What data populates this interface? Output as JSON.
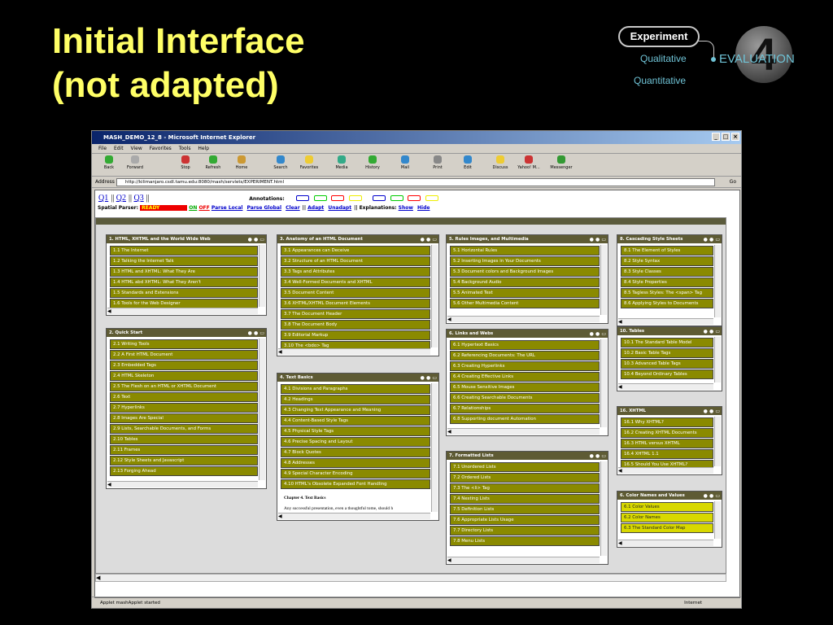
{
  "slide": {
    "title_line1": "Initial Interface",
    "title_line2": "(not adapted)",
    "badge": "Experiment",
    "qualitative": "Qualitative",
    "quantitative": "Quantitative",
    "evaluation": "EVALUATION",
    "number": "4"
  },
  "window": {
    "title": "MASH_DEMO_12_8 - Microsoft Internet Explorer",
    "menu": [
      "File",
      "Edit",
      "View",
      "Favorites",
      "Tools",
      "Help"
    ],
    "toolbar": [
      "Back",
      "Forward",
      "Stop",
      "Refresh",
      "Home",
      "Search",
      "Favorites",
      "Media",
      "History",
      "Mail",
      "Print",
      "Edit",
      "Discuss",
      "Yahoo! M...",
      "Messenger"
    ],
    "address_label": "Address",
    "url": "http://kilimanjaro.csdl.tamu.edu:8080/mash/servlets/EXPERIMENT.html",
    "go": "Go",
    "status_left": "Applet mashApplet started",
    "status_right": "Internet"
  },
  "app": {
    "q": [
      "Q1",
      "Q2",
      "Q3"
    ],
    "annotations": "Annotations:",
    "spatial_parser": "Spatial Parser:",
    "ready": "READY",
    "on": "ON",
    "off": "OFF",
    "parse_local": "Parse Local",
    "parse_global": "Parse Global",
    "clear": "Clear",
    "adapt": "Adapt",
    "unadapt": "Unadapt",
    "explanations": "Explanations:",
    "show": "Show",
    "hide": "Hide",
    "chapter_title": "Chapter 4. Text Basics",
    "chapter_text": "Any successful presentation, even a thoughtful tome, should h"
  },
  "panels": [
    {
      "title": "1. HTML, XHTML and the World Wide Web",
      "items": [
        "1.1 The Internet",
        "1.2 Talking the Internet Talk",
        "1.3 HTML and XHTML: What They Are",
        "1.4 HTML abd XHTML: What They Aren't",
        "1.5 Standards and Extensions",
        "1.6 Tools for the Web Designer"
      ]
    },
    {
      "title": "2. Quick Start",
      "items": [
        "2.1 Writing Tools",
        "2.2 A First HTML Document",
        "2.3 Embedded Tags",
        "2.4 HTML Skeleton",
        "2.5 The Flesh on an HTML or XHTML Document",
        "2.6 Text",
        "2.7 Hyperlinks",
        "2.8 Images Are Special",
        "2.9 Lists, Searchable Documents, and Forms",
        "2.10 Tables",
        "2.11 Frames",
        "2.12 Style Sheets and Javascript",
        "2.13 Forging Ahead"
      ]
    },
    {
      "title": "3. Anatomy of an HTML Document",
      "items": [
        "3.1 Appearances can Deceive",
        "3.2 Structure of an HTML Document",
        "3.3 Tags and Attributes",
        "3.4 Well-Formed Documents and XHTML",
        "3.5 Document Content",
        "3.6 XHTML/XHTML Document Elements",
        "3.7 The Document Header",
        "3.8 The Document Body",
        "3.9 Editorial Markup",
        "3.10 The <bdo> Tag"
      ]
    },
    {
      "title": "4. Text Basics",
      "items": [
        "4.1 Divisions and Paragraphs",
        "4.2 Headings",
        "4.3 Changing Text Appearance and Meaning",
        "4.4 Content-Based Style Tags",
        "4.5 Physical Style Tags",
        "4.6 Precise Spacing and Layout",
        "4.7 Block Quotes",
        "4.8 Addresses",
        "4.9 Special Character Encoding",
        "4.10 HTML's Obsolete Expanded Font Handling"
      ]
    },
    {
      "title": "5. Rules Images, and Multimedia",
      "items": [
        "5.1 Horizontal Rules",
        "5.2 Inserting Images in Your Documents",
        "5.3 Document colors and Background Images",
        "5.4 Background Audio",
        "5.5 Animated Text",
        "5.6 Other Multimedia Content"
      ]
    },
    {
      "title": "6. Links and Webs",
      "items": [
        "6.1 Hypertext Basics",
        "6.2 Referencing Documents: The URL",
        "6.3 Creating Hyperlinks",
        "6.4 Creating Effective Links",
        "6.5 Mouse Sensitive Images",
        "6.6 Creating Searchable Documents",
        "6.7 Relationships",
        "6.8 Supporting document Automation"
      ]
    },
    {
      "title": "7. Formatted Lists",
      "items": [
        "7.1 Unordered Lists",
        "7.2 Ordered Lists",
        "7.3 The <li> Tag",
        "7.4 Nesting Lists",
        "7.5 Definition Lists",
        "7.6 Appropriate Lists Usage",
        "7.7 Directory Lists",
        "7.8 Menu Lists"
      ]
    },
    {
      "title": "8. Cascading Style Sheets",
      "items": [
        "8.1 The Element of Styles",
        "8.2 Style Syntax",
        "8.3 Style Classes",
        "8.4 Style Properties",
        "8.5 Tagless Styles: The <span> Tag",
        "8.6 Applying Styles to Documents"
      ]
    },
    {
      "title": "10. Tables",
      "items": [
        "10.1 The Standard Table Model",
        "10.2 Basic Table Tags",
        "10.3 Advanced Table Tags",
        "10.4 Beyond Ordinary Tables"
      ]
    },
    {
      "title": "16. XHTML",
      "items": [
        "16.1 Why XHTML?",
        "16.2 Creating XHTML Documents",
        "16.3 HTML versus XHTML",
        "16.4 XHTML 1.1",
        "16.5 Should You Use XHTML?"
      ]
    },
    {
      "title": "6. Color Names and Values",
      "items": [
        "6.1 Color Values",
        "6.2 Color Names",
        "6.3 The Standard Color Map"
      ]
    }
  ]
}
